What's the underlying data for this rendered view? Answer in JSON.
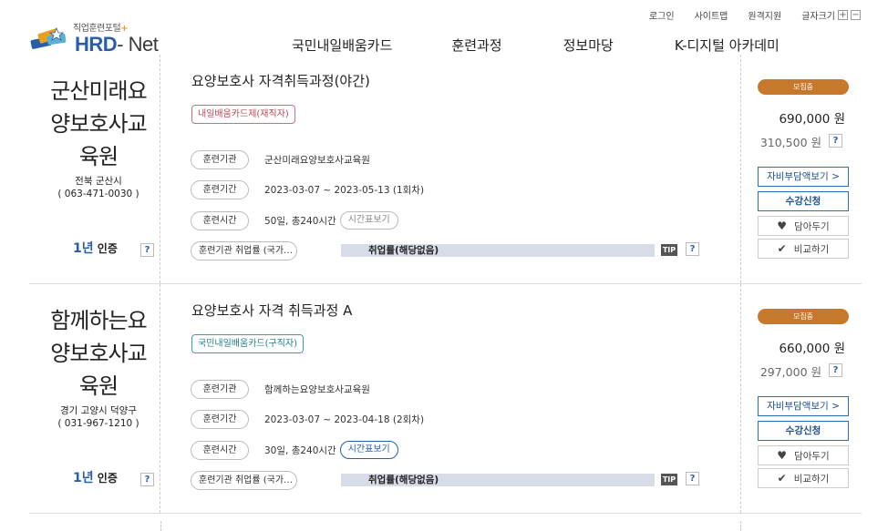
{
  "header": {
    "logo": {
      "sub": "직업훈련포털",
      "sub_plus": "+",
      "main_hrd": "HRD",
      "main_net": "- Net"
    },
    "util": {
      "login": "로그인",
      "sitemap": "사이트맵",
      "remote": "원격지원",
      "font_size": "글자크기",
      "plus": "+",
      "minus": "−"
    },
    "nav": [
      "국민내일배움카드",
      "훈련과정",
      "정보마당",
      "K-디지털 아카데미"
    ]
  },
  "labels": {
    "institution": "훈련기관",
    "period": "훈련기간",
    "hours": "훈련시간",
    "employment": "훈련기관 취업률 (국가…",
    "time_table": "시간표보기",
    "tip": "TIP",
    "help": "?",
    "cert_year": "1년",
    "cert_label": " 인증",
    "support_btn": "자비부담액보기 >",
    "apply_btn": "수강신청",
    "wish_btn": "담아두기",
    "compare_btn": "비교하기",
    "status": "모집중"
  },
  "courses": [
    {
      "inst_name": "군산미래요양보호사교육원",
      "inst_name_lines": [
        "군산미래요",
        "양보호사교",
        "육원"
      ],
      "region": "전북 군산시",
      "phone": "( 063-471-0030 )",
      "title": "요양보호사 자격취득과정(야간)",
      "tag": "내일배움카드제(재직자)",
      "institution": "군산미래요양보호사교육원",
      "period": "2023-03-07 ~ 2023-05-13 (1회차)",
      "hours": "50일, 총240시간",
      "employment": "취업률(해당없음)",
      "price": "690,000 원",
      "self_pay": "310,500 원"
    },
    {
      "inst_name": "함께하는요양보호사교육원",
      "inst_name_lines": [
        "함께하는요",
        "양보호사교",
        "육원"
      ],
      "region": "경기 고양시 덕양구",
      "phone": "( 031-967-1210 )",
      "title": "요양보호사 자격 취득과정 A",
      "tag": "국민내일배움카드(구직자)",
      "institution": "함께하는요양보호사교육원",
      "period": "2023-03-07 ~ 2023-04-18 (2회차)",
      "hours": "30일, 총240시간",
      "employment": "취업률(해당없음)",
      "price": "660,000 원",
      "self_pay": "297,000 원"
    }
  ],
  "colors": {
    "brand_blue": "#2a5fa8",
    "status_orange": "#c8782a",
    "tag_red": "#b5485a",
    "tag_teal": "#1f7f88",
    "employment_bar": "#d8dce8"
  }
}
